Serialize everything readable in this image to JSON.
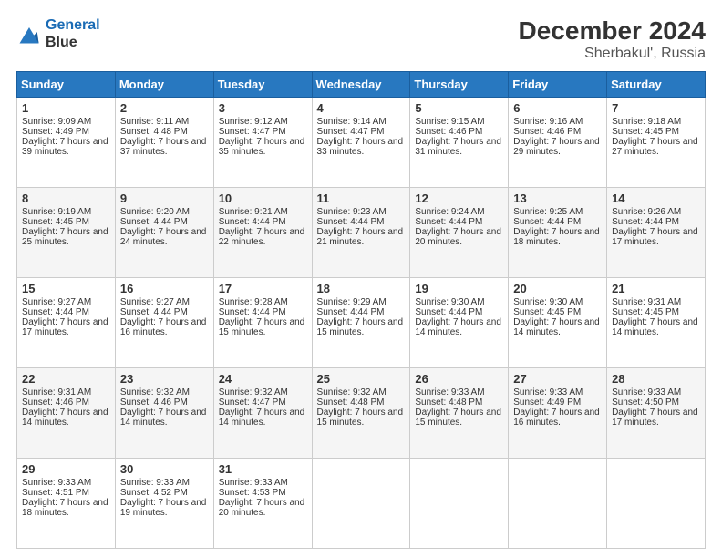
{
  "header": {
    "logo_line1": "General",
    "logo_line2": "Blue",
    "title": "December 2024",
    "subtitle": "Sherbakul', Russia"
  },
  "days_of_week": [
    "Sunday",
    "Monday",
    "Tuesday",
    "Wednesday",
    "Thursday",
    "Friday",
    "Saturday"
  ],
  "weeks": [
    [
      {
        "day": 1,
        "sunrise": "9:09 AM",
        "sunset": "4:49 PM",
        "daylight": "7 hours and 39 minutes."
      },
      {
        "day": 2,
        "sunrise": "9:11 AM",
        "sunset": "4:48 PM",
        "daylight": "7 hours and 37 minutes."
      },
      {
        "day": 3,
        "sunrise": "9:12 AM",
        "sunset": "4:47 PM",
        "daylight": "7 hours and 35 minutes."
      },
      {
        "day": 4,
        "sunrise": "9:14 AM",
        "sunset": "4:47 PM",
        "daylight": "7 hours and 33 minutes."
      },
      {
        "day": 5,
        "sunrise": "9:15 AM",
        "sunset": "4:46 PM",
        "daylight": "7 hours and 31 minutes."
      },
      {
        "day": 6,
        "sunrise": "9:16 AM",
        "sunset": "4:46 PM",
        "daylight": "7 hours and 29 minutes."
      },
      {
        "day": 7,
        "sunrise": "9:18 AM",
        "sunset": "4:45 PM",
        "daylight": "7 hours and 27 minutes."
      }
    ],
    [
      {
        "day": 8,
        "sunrise": "9:19 AM",
        "sunset": "4:45 PM",
        "daylight": "7 hours and 25 minutes."
      },
      {
        "day": 9,
        "sunrise": "9:20 AM",
        "sunset": "4:44 PM",
        "daylight": "7 hours and 24 minutes."
      },
      {
        "day": 10,
        "sunrise": "9:21 AM",
        "sunset": "4:44 PM",
        "daylight": "7 hours and 22 minutes."
      },
      {
        "day": 11,
        "sunrise": "9:23 AM",
        "sunset": "4:44 PM",
        "daylight": "7 hours and 21 minutes."
      },
      {
        "day": 12,
        "sunrise": "9:24 AM",
        "sunset": "4:44 PM",
        "daylight": "7 hours and 20 minutes."
      },
      {
        "day": 13,
        "sunrise": "9:25 AM",
        "sunset": "4:44 PM",
        "daylight": "7 hours and 18 minutes."
      },
      {
        "day": 14,
        "sunrise": "9:26 AM",
        "sunset": "4:44 PM",
        "daylight": "7 hours and 17 minutes."
      }
    ],
    [
      {
        "day": 15,
        "sunrise": "9:27 AM",
        "sunset": "4:44 PM",
        "daylight": "7 hours and 17 minutes."
      },
      {
        "day": 16,
        "sunrise": "9:27 AM",
        "sunset": "4:44 PM",
        "daylight": "7 hours and 16 minutes."
      },
      {
        "day": 17,
        "sunrise": "9:28 AM",
        "sunset": "4:44 PM",
        "daylight": "7 hours and 15 minutes."
      },
      {
        "day": 18,
        "sunrise": "9:29 AM",
        "sunset": "4:44 PM",
        "daylight": "7 hours and 15 minutes."
      },
      {
        "day": 19,
        "sunrise": "9:30 AM",
        "sunset": "4:44 PM",
        "daylight": "7 hours and 14 minutes."
      },
      {
        "day": 20,
        "sunrise": "9:30 AM",
        "sunset": "4:45 PM",
        "daylight": "7 hours and 14 minutes."
      },
      {
        "day": 21,
        "sunrise": "9:31 AM",
        "sunset": "4:45 PM",
        "daylight": "7 hours and 14 minutes."
      }
    ],
    [
      {
        "day": 22,
        "sunrise": "9:31 AM",
        "sunset": "4:46 PM",
        "daylight": "7 hours and 14 minutes."
      },
      {
        "day": 23,
        "sunrise": "9:32 AM",
        "sunset": "4:46 PM",
        "daylight": "7 hours and 14 minutes."
      },
      {
        "day": 24,
        "sunrise": "9:32 AM",
        "sunset": "4:47 PM",
        "daylight": "7 hours and 14 minutes."
      },
      {
        "day": 25,
        "sunrise": "9:32 AM",
        "sunset": "4:48 PM",
        "daylight": "7 hours and 15 minutes."
      },
      {
        "day": 26,
        "sunrise": "9:33 AM",
        "sunset": "4:48 PM",
        "daylight": "7 hours and 15 minutes."
      },
      {
        "day": 27,
        "sunrise": "9:33 AM",
        "sunset": "4:49 PM",
        "daylight": "7 hours and 16 minutes."
      },
      {
        "day": 28,
        "sunrise": "9:33 AM",
        "sunset": "4:50 PM",
        "daylight": "7 hours and 17 minutes."
      }
    ],
    [
      {
        "day": 29,
        "sunrise": "9:33 AM",
        "sunset": "4:51 PM",
        "daylight": "7 hours and 18 minutes."
      },
      {
        "day": 30,
        "sunrise": "9:33 AM",
        "sunset": "4:52 PM",
        "daylight": "7 hours and 19 minutes."
      },
      {
        "day": 31,
        "sunrise": "9:33 AM",
        "sunset": "4:53 PM",
        "daylight": "7 hours and 20 minutes."
      },
      null,
      null,
      null,
      null
    ]
  ]
}
